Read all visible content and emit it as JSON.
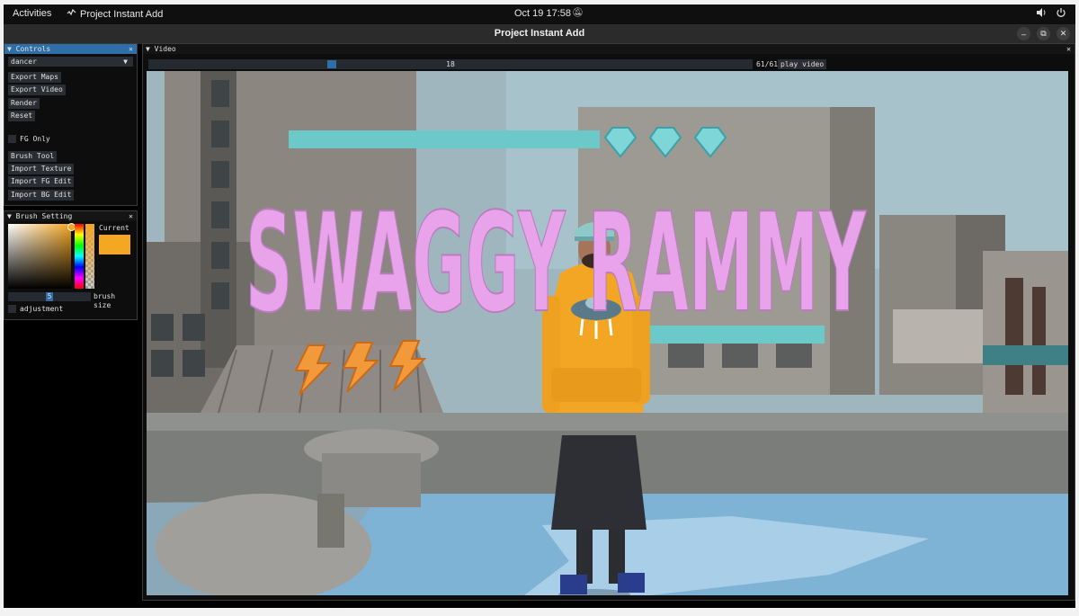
{
  "topbar": {
    "activities": "Activities",
    "app_name": "Project Instant Add",
    "clock": "Oct 19  17:58",
    "icons": [
      "notifications-muted-icon",
      "volume-icon",
      "power-icon"
    ]
  },
  "window": {
    "title": "Project Instant Add",
    "buttons": [
      "minimize-icon",
      "maximize-icon",
      "close-icon"
    ]
  },
  "controls": {
    "title": "Controls",
    "selected_object": "dancer",
    "buttons": [
      "Export Maps",
      "Export Video",
      "Render",
      "Reset"
    ],
    "fg_only_label": "FG Only",
    "buttons2": [
      "Brush Tool",
      "Import Texture",
      "Import FG Edit",
      "Import BG Edit"
    ]
  },
  "brush": {
    "title": "Brush Setting",
    "current_label": "Current",
    "current_color": "#f5a623",
    "size_value": "5",
    "size_label": "brush size",
    "adjustment_label": "adjustment"
  },
  "video": {
    "title": "Video",
    "frame_value": "18",
    "frame_count": "61/61",
    "play_label": "play video",
    "progress_fraction": 0.3,
    "overlay_text": "SWAGGY RAMMY",
    "overlay_color": "#e8a3ea",
    "bar_color": "#6cc9c9"
  }
}
